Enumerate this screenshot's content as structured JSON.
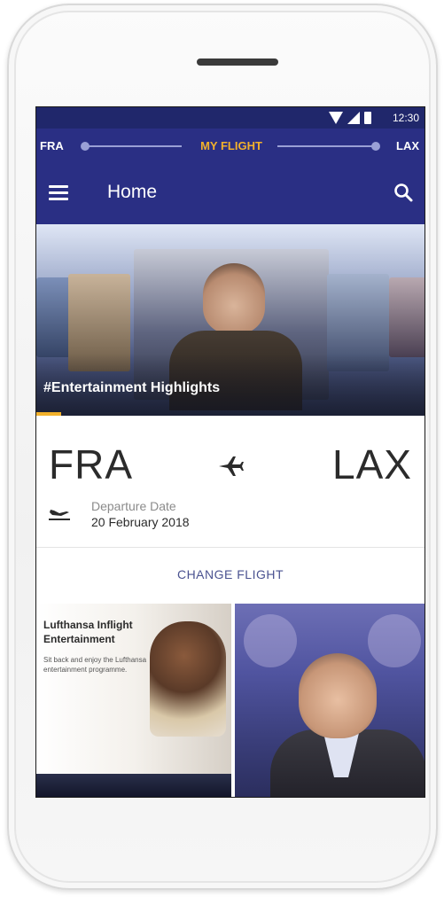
{
  "status_bar": {
    "time": "12:30"
  },
  "flight_strip": {
    "origin": "FRA",
    "title": "MY FLIGHT",
    "destination": "LAX"
  },
  "header": {
    "title": "Home"
  },
  "hero": {
    "caption": "#Entertainment Highlights"
  },
  "route": {
    "origin": "FRA",
    "destination": "LAX",
    "departure_label": "Departure Date",
    "departure_date": "20 February 2018"
  },
  "actions": {
    "change_flight": "CHANGE FLIGHT"
  },
  "tiles": {
    "left_title": "Lufthansa Inflight Entertainment",
    "left_text": "Sit back and enjoy the Lufthansa entertainment programme."
  },
  "colors": {
    "brand_blue": "#2a2f84",
    "accent_yellow": "#f2b12b",
    "link_blue": "#4a5290"
  },
  "icons": {
    "menu": "menu-icon",
    "search": "search-icon",
    "plane": "plane-icon",
    "departure": "departure-plane-icon",
    "wifi": "wifi-icon",
    "signal": "signal-icon",
    "battery": "battery-icon"
  }
}
